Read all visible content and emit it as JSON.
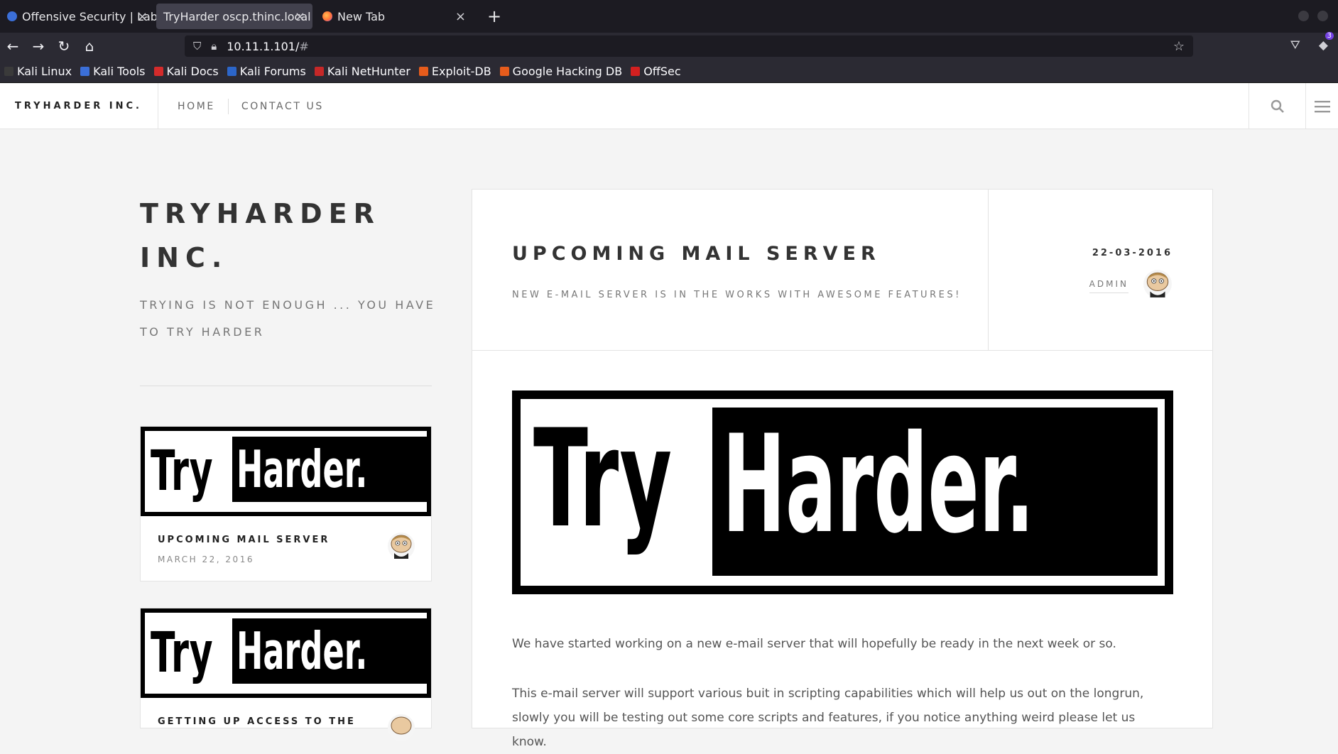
{
  "browser": {
    "tabs": [
      {
        "label": "Offensive Security | Labs",
        "active": false
      },
      {
        "label": "TryHarder oscp.thinc.local",
        "active": true
      },
      {
        "label": "New Tab",
        "active": false
      }
    ],
    "new_tab_icon": "plus-icon",
    "url": "10.11.1.101/",
    "url_hash": "#",
    "extension_badge": "3",
    "bookmarks": [
      {
        "label": "Kali Linux",
        "color": "#3a3a3a"
      },
      {
        "label": "Kali Tools",
        "color": "#3b6fd8"
      },
      {
        "label": "Kali Docs",
        "color": "#d42b2b"
      },
      {
        "label": "Kali Forums",
        "color": "#2c66c9"
      },
      {
        "label": "Kali NetHunter",
        "color": "#c62828"
      },
      {
        "label": "Exploit-DB",
        "color": "#e65c1c"
      },
      {
        "label": "Google Hacking DB",
        "color": "#e65c1c"
      },
      {
        "label": "OffSec",
        "color": "#d32020"
      }
    ]
  },
  "site": {
    "brand": "TRYHARDER INC.",
    "menu": [
      "HOME",
      "CONTACT US"
    ],
    "search_icon": "search-icon",
    "menu_icon": "hamburger-icon"
  },
  "sidebar": {
    "title": "TRYHARDER INC.",
    "tagline": "TRYING IS NOT ENOUGH ... YOU HAVE TO TRY HARDER",
    "posts": [
      {
        "title": "UPCOMING MAIL SERVER",
        "date": "MARCH 22, 2016"
      },
      {
        "title": "GETTING UP ACCESS TO THE",
        "date": ""
      }
    ]
  },
  "article": {
    "title": "UPCOMING MAIL SERVER",
    "subtitle": "NEW E-MAIL SERVER IS IN THE WORKS WITH AWESOME FEATURES!",
    "date": "22-03-2016",
    "author": "ADMIN",
    "logo_text_a": "Try",
    "logo_text_b": "Harder.",
    "paragraphs": [
      "We have started working on a new e-mail server that will hopefully be ready in the next week or so.",
      "This e-mail server will support various buit in scripting capabilities which will help us out on the longrun, slowly you will be testing out some core scripts and features, if you notice anything weird please let us know."
    ]
  }
}
